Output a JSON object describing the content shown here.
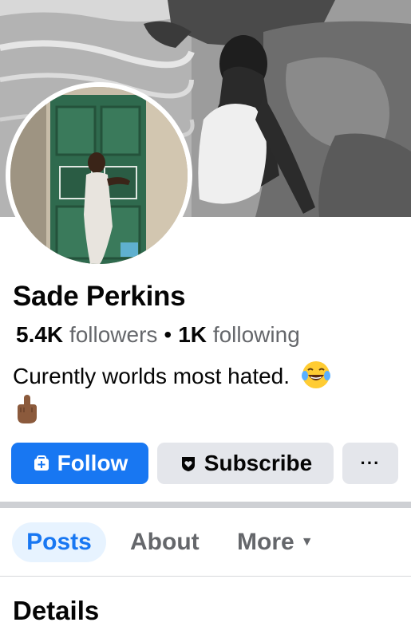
{
  "profile": {
    "name": "Sade Perkins",
    "followers_count": "5.4K",
    "followers_label": "followers",
    "separator": "•",
    "following_count": "1K",
    "following_label": "following",
    "bio_text": "Curently worlds most hated.",
    "bio_emojis": [
      "face-with-tears-of-joy",
      "middle-finger-medium-dark-skin"
    ]
  },
  "actions": {
    "follow_label": "Follow",
    "follow_icon": "add-friend-icon",
    "subscribe_label": "Subscribe",
    "subscribe_icon": "heart-badge-icon",
    "more_label": "···"
  },
  "tabs": [
    {
      "label": "Posts",
      "active": true
    },
    {
      "label": "About",
      "active": false
    },
    {
      "label": "More",
      "active": false
    }
  ],
  "section": {
    "title": "Details"
  },
  "colors": {
    "accent": "#1877f2",
    "accent_soft": "#e7f3ff",
    "secondary_button": "#e4e6eb",
    "muted_text": "#65676b"
  }
}
